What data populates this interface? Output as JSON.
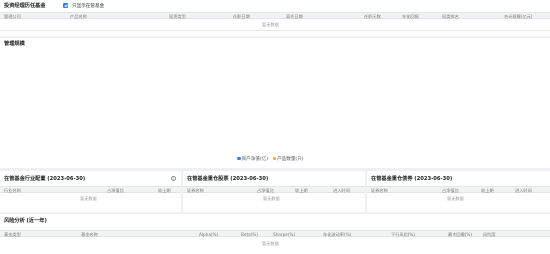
{
  "history": {
    "title": "投资经理历任基金",
    "checkbox_label": "只显示在管基金",
    "columns": [
      "管理公司",
      "产品名称",
      "投资类型",
      "任职日期",
      "离任日期",
      "任职天数",
      "年化回报",
      "同类排名",
      "合计规模(亿元)"
    ],
    "empty": "暂无数据"
  },
  "scale": {
    "title": "管理规模",
    "legend": [
      {
        "label": "资产净值(亿)",
        "color": "#3b7fd9"
      },
      {
        "label": "产品数量(只)",
        "color": "#f5a623"
      }
    ]
  },
  "industry": {
    "title": "在管基金行业配置 (2023-06-30)",
    "columns": [
      "行业名称",
      "占净值比",
      "较上期"
    ],
    "empty": "暂无数据",
    "info_icon": "info-icon"
  },
  "stocks": {
    "title": "在管基金重仓股票 (2023-06-30)",
    "columns": [
      "证券名称",
      "占净值比",
      "较上期",
      "进入时间"
    ],
    "empty": "暂无数据"
  },
  "bonds": {
    "title": "在管基金重仓债券 (2023-06-30)",
    "columns": [
      "证券名称",
      "占净值比",
      "较上期",
      "进入时间"
    ],
    "empty": "暂无数据"
  },
  "risk": {
    "title": "风险分析 (近一年)",
    "columns": [
      "基金类型",
      "基金名称",
      "Alpha(%)",
      "Beta(%)",
      "Sharpe(%)",
      "年化波动率(%)",
      "下行风险(%)",
      "最大回撤(%)",
      "风险度"
    ],
    "empty": "暂无数据"
  }
}
